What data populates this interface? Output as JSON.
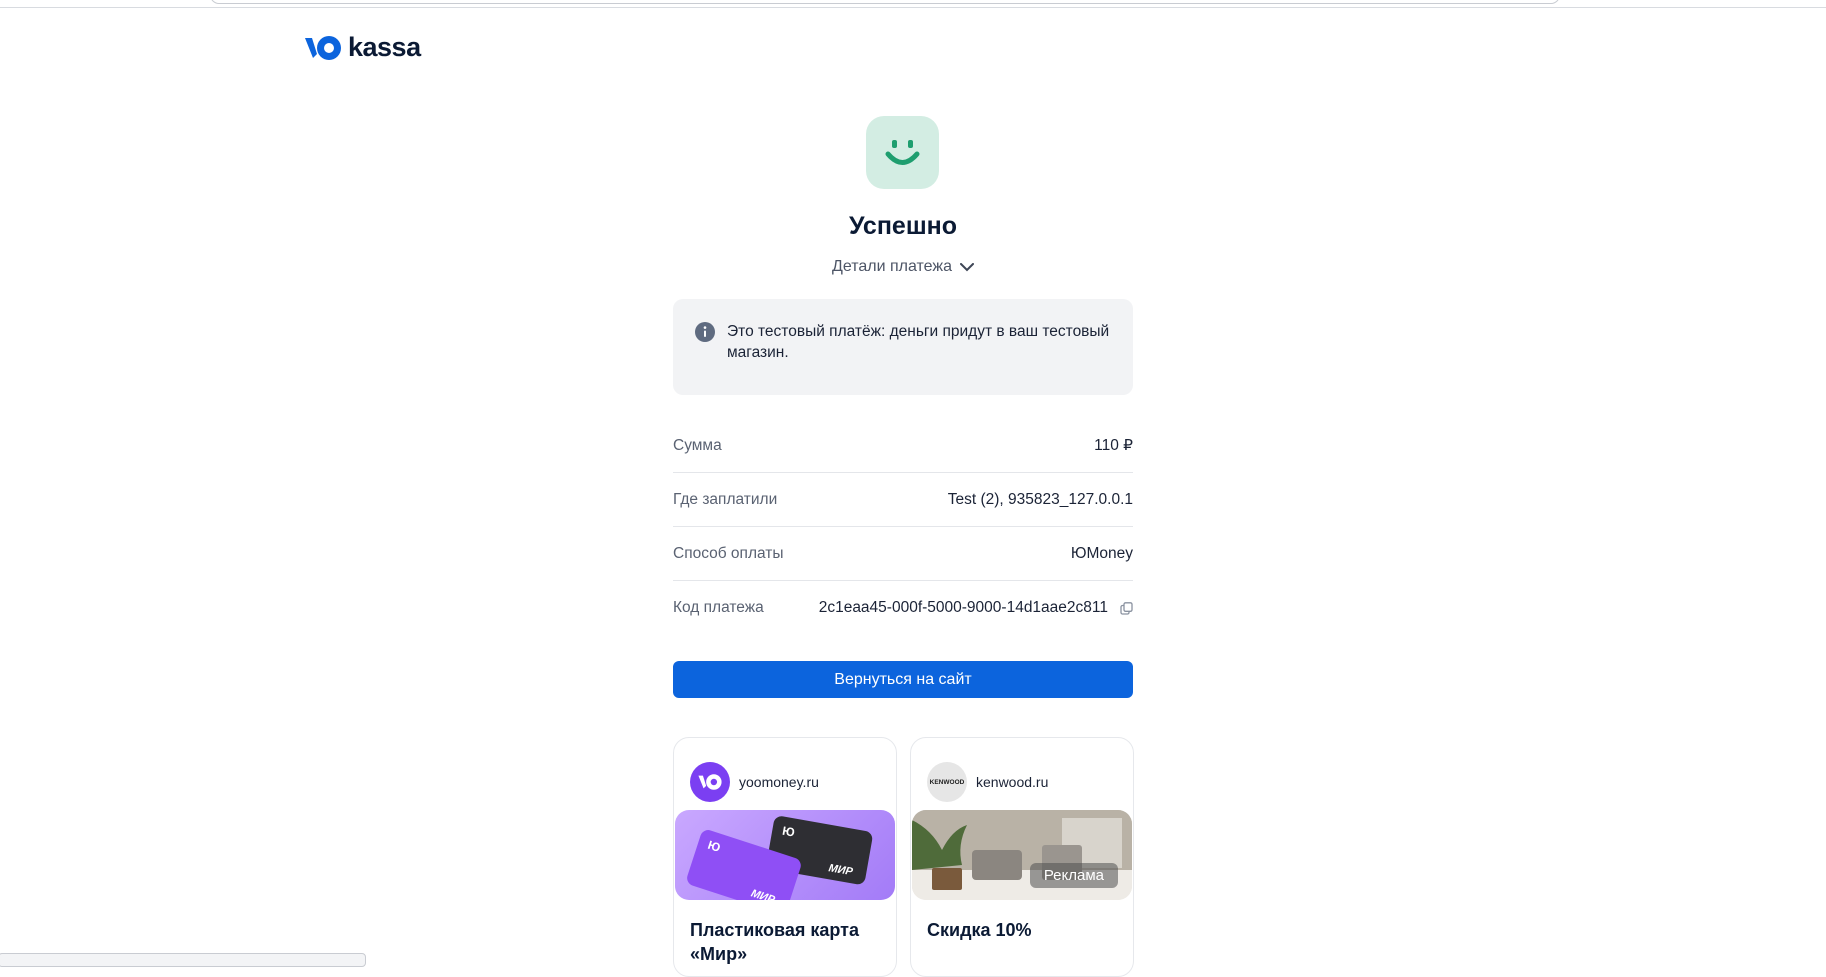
{
  "brand": {
    "logo_text": "kassa",
    "logo_icon": "yoo-logo-icon"
  },
  "status": {
    "icon": "smile-icon",
    "title": "Успешно",
    "details_label": "Детали платежа"
  },
  "notice": {
    "icon": "info-icon",
    "text": "Это тестовый платёж: деньги придут в ваш тестовый магазин."
  },
  "payment": {
    "rows": [
      {
        "label": "Сумма",
        "value": "110 ₽"
      },
      {
        "label": "Где заплатили",
        "value": "Test (2), 935823_127.0.0.1"
      },
      {
        "label": "Способ оплаты",
        "value": "ЮMoney"
      },
      {
        "label": "Код платежа",
        "value": "2c1eaa45-000f-5000-9000-14d1aae2c811"
      }
    ],
    "copy_icon": "copy-icon"
  },
  "actions": {
    "return_label": "Вернуться на сайт"
  },
  "promos": [
    {
      "site": "yoomoney.ru",
      "title": "Пластиковая карта «Мир»",
      "card_label_1": "Ю",
      "card_label_2": "МИР"
    },
    {
      "site": "kenwood.ru",
      "avatar_text": "KENWOOD",
      "title": "Скидка 10%",
      "badge": "Реклама"
    }
  ],
  "colors": {
    "primary": "#0c64dd",
    "success_bg": "#d3ede3",
    "success_fg": "#1e9e6f",
    "promo_purple": "#7b3ff2"
  }
}
